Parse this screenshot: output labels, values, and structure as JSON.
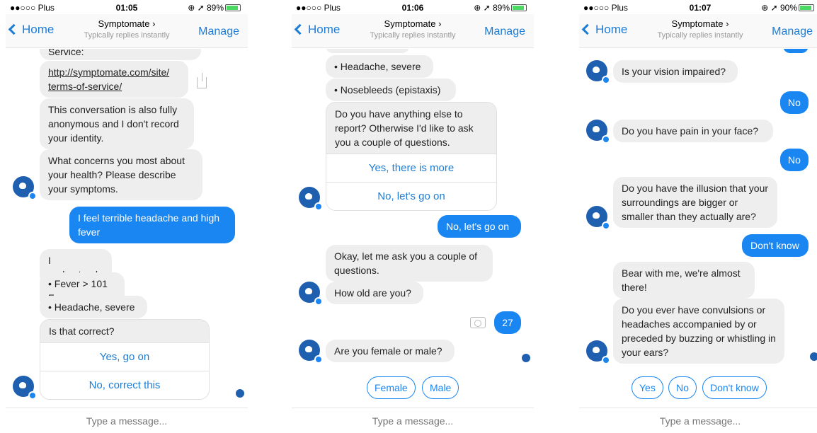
{
  "screens": [
    {
      "status": {
        "carrier": "●●○○○ Plus ⁠",
        "time": "01:05",
        "right": "⊕ ➚ 89%"
      },
      "nav": {
        "back": "Home",
        "title": "Symptomate ›",
        "subtitle": "Typically replies instantly",
        "manage": "Manage"
      },
      "messages": {
        "m1": "Service:",
        "m2": "http://symptomate.com/site/ terms-of-service/",
        "m3": "This conversation is also fully anonymous and I don't record your identity.",
        "m4": "What concerns you most about your health? Please describe your symptoms.",
        "m5": "I feel terrible headache and high fever",
        "m6": "I understood:",
        "m7": "• Fever > 101 F",
        "m8": "• Headache, severe",
        "m9": "Is that correct?",
        "opt1": "Yes, go on",
        "opt2": "No, correct this"
      },
      "composer": {
        "placeholder": "Type a message..."
      }
    },
    {
      "status": {
        "carrier": "●●○○○ Plus",
        "time": "01:06",
        "right": "⊕ ➚ 89%"
      },
      "nav": {
        "back": "Home",
        "title": "Symptomate ›",
        "subtitle": "Typically replies instantly",
        "manage": "Manage"
      },
      "messages": {
        "m1": "• Headache, severe",
        "m2": "• Nosebleeds (epistaxis)",
        "m3": "Do you have anything else to report? Otherwise I'd like to ask you a couple of questions.",
        "opt1": "Yes, there is more",
        "opt2": "No, let's go on",
        "m4": "No, let's go on",
        "m5": "Okay, let me ask you a couple of questions.",
        "m6": "How old are you?",
        "m7": "27",
        "m8": "Are you female or male?",
        "qr1": "Female",
        "qr2": "Male"
      },
      "composer": {
        "placeholder": "Type a message..."
      }
    },
    {
      "status": {
        "carrier": "●●○○○ Plus",
        "time": "01:07",
        "right": "⊕ ➚ 90%"
      },
      "nav": {
        "back": "Home",
        "title": "Symptomate ›",
        "subtitle": "Typically replies instantly",
        "manage": "Manage"
      },
      "messages": {
        "m1": "Is your vision impaired?",
        "m2": "No",
        "m3": "Do you have pain in your face?",
        "m4": "No",
        "m5": "Do you have the illusion that your surroundings are bigger or smaller than they actually are?",
        "m6": "Don't know",
        "m7": "Bear with me, we're almost there!",
        "m8": "Do you ever have convulsions or headaches accompanied by or preceded by buzzing or whistling in your ears?",
        "qr1": "Yes",
        "qr2": "No",
        "qr3": "Don't know"
      },
      "composer": {
        "placeholder": "Type a message..."
      }
    }
  ],
  "colors": {
    "accent": "#1a86f2",
    "bot_bubble": "#eeeeee",
    "avatar": "#1e5fb0"
  }
}
